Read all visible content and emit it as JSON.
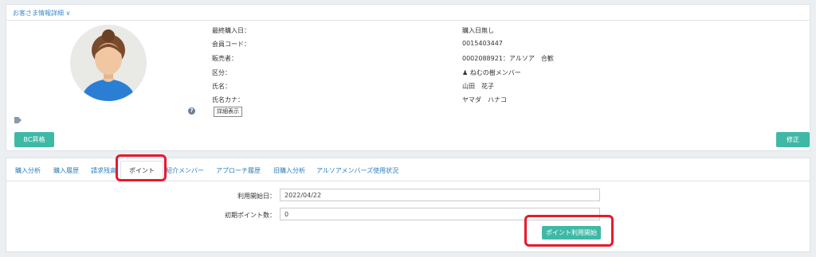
{
  "header": {
    "title": "お客さま情報詳細",
    "chevron": "chevron-down-icon"
  },
  "customer": {
    "labels": [
      "最終購入日：",
      "会員コード：",
      "販売者：",
      "区分：",
      "氏名：",
      "氏名カナ："
    ],
    "values": [
      "購入日無し",
      "0015403447",
      "0002088921：アルソア　合歓",
      "ねむの樹メンバー",
      "山田　花子",
      "ヤマダ　ハナコ"
    ],
    "detail_button": "詳細表示"
  },
  "buttons": {
    "bc": "BC昇格",
    "edit": "修正",
    "point_start": "ポイント利用開始"
  },
  "tabs": [
    "購入分析",
    "購入履歴",
    "請求残高",
    "ポイント",
    "紹介メンバー",
    "アプローチ履歴",
    "旧購入分析",
    "アルソアメンバーズ使用状況"
  ],
  "active_tab": "ポイント",
  "point_form": {
    "start_date_label": "利用開始日：",
    "start_date_value": "2022/04/22",
    "initial_points_label": "初期ポイント数：",
    "initial_points_value": "0"
  },
  "colors": {
    "accent": "#3fb9a6",
    "link": "#2d7fbf",
    "highlight": "#e8192c"
  }
}
